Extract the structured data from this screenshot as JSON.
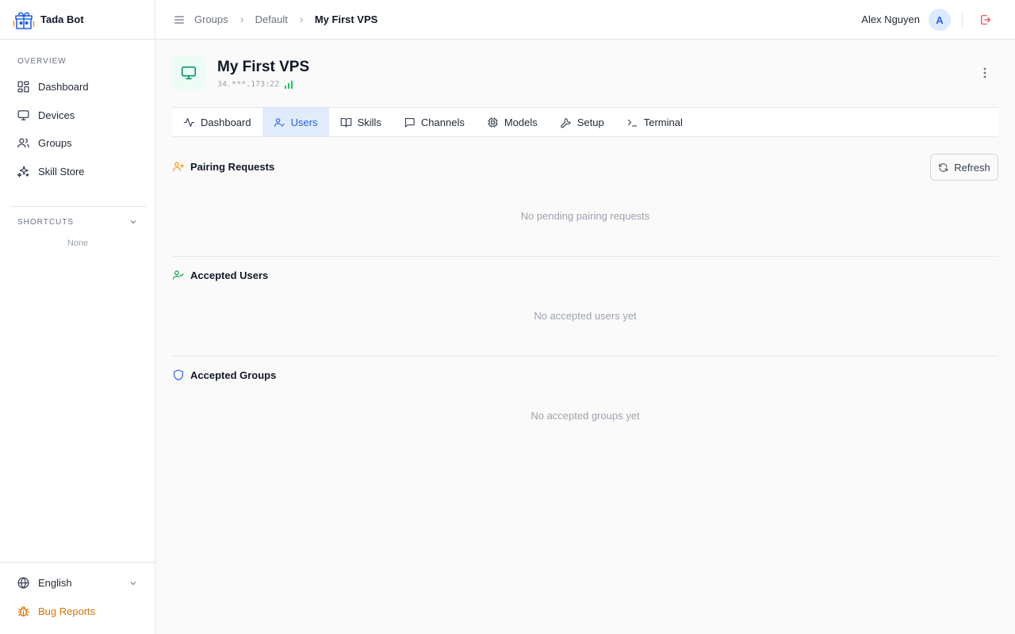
{
  "brand": {
    "name": "Tada Bot",
    "logo_icon": "gift-bot-logo"
  },
  "sidebar": {
    "overview_label": "OVERVIEW",
    "items": [
      {
        "label": "Dashboard",
        "icon": "layout-grid-icon"
      },
      {
        "label": "Devices",
        "icon": "monitor-icon"
      },
      {
        "label": "Groups",
        "icon": "users-icon"
      },
      {
        "label": "Skill Store",
        "icon": "sparkles-icon"
      }
    ],
    "shortcuts_label": "SHORTCUTS",
    "shortcuts_empty": "None",
    "language": "English",
    "bug_reports": "Bug Reports"
  },
  "topbar": {
    "breadcrumb": [
      "Groups",
      "Default",
      "My First VPS"
    ],
    "user_name": "Alex Nguyen",
    "avatar_initial": "A"
  },
  "device": {
    "title": "My First VPS",
    "ip": "34.***.173:22",
    "status_color": "#22c55e"
  },
  "tabs": [
    {
      "label": "Dashboard",
      "icon": "activity-icon",
      "active": false
    },
    {
      "label": "Users",
      "icon": "user-check-icon",
      "active": true
    },
    {
      "label": "Skills",
      "icon": "book-open-icon",
      "active": false
    },
    {
      "label": "Channels",
      "icon": "message-square-icon",
      "active": false
    },
    {
      "label": "Models",
      "icon": "cpu-icon",
      "active": false
    },
    {
      "label": "Setup",
      "icon": "wrench-icon",
      "active": false
    },
    {
      "label": "Terminal",
      "icon": "terminal-icon",
      "active": false
    }
  ],
  "pairing": {
    "title": "Pairing Requests",
    "refresh_label": "Refresh",
    "empty": "No pending pairing requests",
    "icon_color": "#f59e0b"
  },
  "accepted_users": {
    "title": "Accepted Users",
    "empty": "No accepted users yet",
    "icon_color": "#16a34a"
  },
  "accepted_groups": {
    "title": "Accepted Groups",
    "empty": "No accepted groups yet",
    "icon_color": "#2563eb"
  },
  "colors": {
    "accent": "#2563eb",
    "warning": "#d97706",
    "danger": "#ef4444",
    "success": "#059669"
  }
}
